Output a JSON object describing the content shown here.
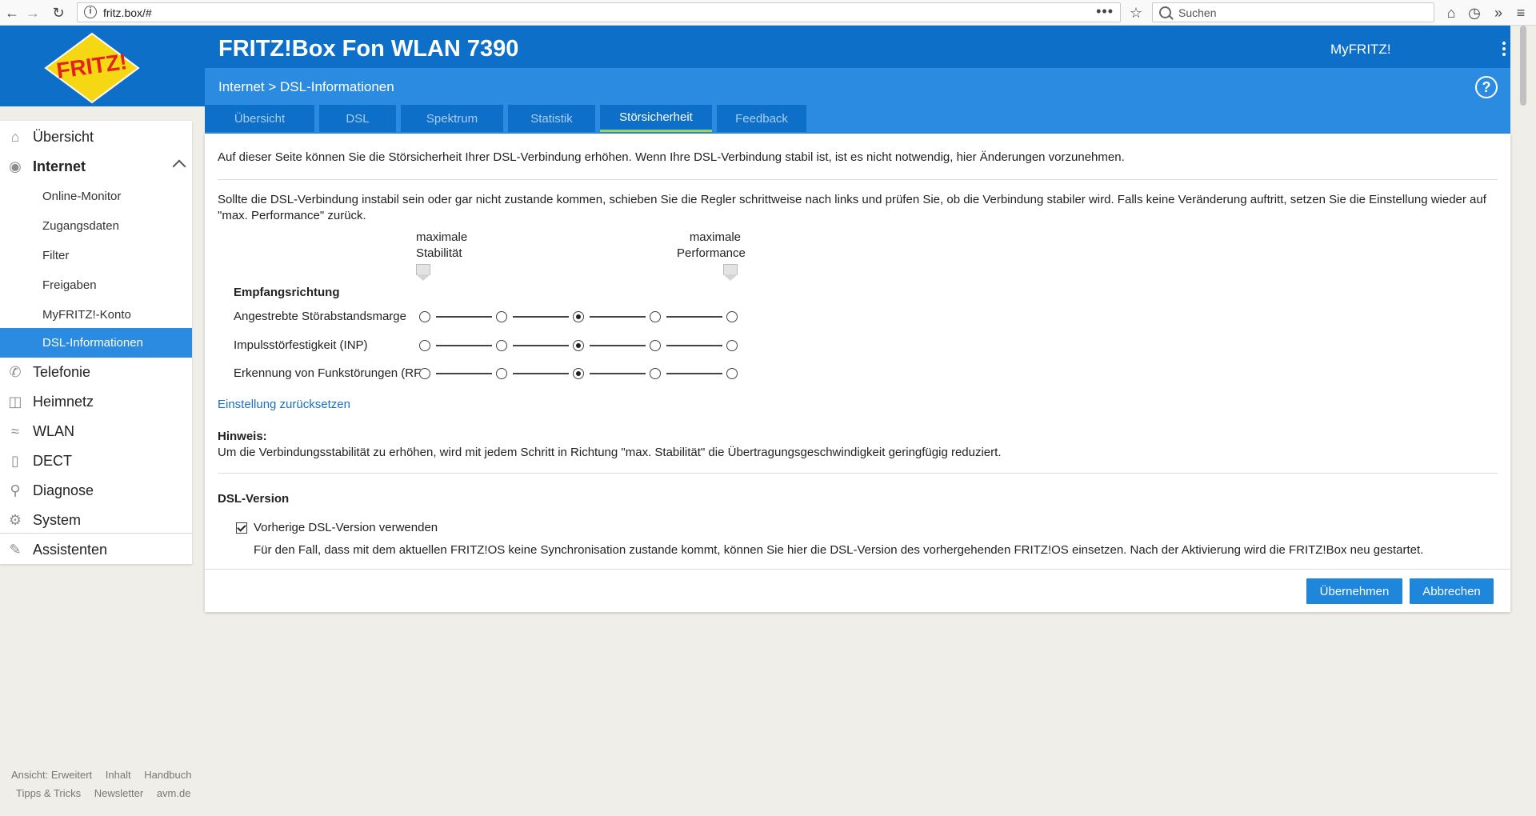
{
  "browser": {
    "url": "fritz.box/#",
    "search_placeholder": "Suchen"
  },
  "header": {
    "product": "FRITZ!Box Fon WLAN 7390",
    "myfritz": "MyFRITZ!",
    "breadcrumb": "Internet > DSL-Informationen",
    "help": "?",
    "logo_text": "FRITZ!"
  },
  "tabs": [
    {
      "label": "Übersicht"
    },
    {
      "label": "DSL"
    },
    {
      "label": "Spektrum"
    },
    {
      "label": "Statistik"
    },
    {
      "label": "Störsicherheit"
    },
    {
      "label": "Feedback"
    }
  ],
  "active_tab": "Störsicherheit",
  "sidebar": {
    "items": [
      {
        "label": "Übersicht",
        "icon": "home-icon"
      },
      {
        "label": "Internet",
        "icon": "globe-icon"
      },
      {
        "label": "Telefonie",
        "icon": "phone-icon"
      },
      {
        "label": "Heimnetz",
        "icon": "network-icon"
      },
      {
        "label": "WLAN",
        "icon": "wifi-icon"
      },
      {
        "label": "DECT",
        "icon": "dect-icon"
      },
      {
        "label": "Diagnose",
        "icon": "diagnose-icon"
      },
      {
        "label": "System",
        "icon": "gear-icon"
      },
      {
        "label": "Assistenten",
        "icon": "wizard-icon"
      }
    ],
    "internet_sub": [
      {
        "label": "Online-Monitor"
      },
      {
        "label": "Zugangsdaten"
      },
      {
        "label": "Filter"
      },
      {
        "label": "Freigaben"
      },
      {
        "label": "MyFRITZ!-Konto"
      },
      {
        "label": "DSL-Informationen"
      }
    ],
    "footer_row1": [
      "Ansicht: Erweitert",
      "Inhalt",
      "Handbuch"
    ],
    "footer_row2": [
      "Tipps & Tricks",
      "Newsletter",
      "avm.de"
    ]
  },
  "main": {
    "intro": "Auf dieser Seite können Sie die Störsicherheit Ihrer DSL-Verbindung erhöhen. Wenn Ihre DSL-Verbindung stabil ist, ist es nicht notwendig, hier Änderungen vorzunehmen.",
    "paragraph": "Sollte die DSL-Verbindung instabil sein oder gar nicht zustande kommen, schieben Sie die Regler schrittweise nach links und prüfen Sie, ob die Verbindung stabiler wird. Falls keine Veränderung auftritt, setzen Sie die Einstellung wieder auf \"max. Performance\" zurück.",
    "label_left_1": "maximale",
    "label_left_2": "Stabilität",
    "label_right_1": "maximale",
    "label_right_2": "Performance",
    "section": "Empfangsrichtung",
    "rows": [
      {
        "label": "Angestrebte Störabstandsmarge",
        "selected": 3
      },
      {
        "label": "Impulsstörfestigkeit (INP)",
        "selected": 3
      },
      {
        "label": "Erkennung von Funkstörungen (RFI)",
        "selected": 3
      }
    ],
    "reset_link": "Einstellung zurücksetzen",
    "hint_title": "Hinweis:",
    "hint_text": "Um die Verbindungsstabilität zu erhöhen, wird mit jedem Schritt in Richtung \"max. Stabilität\" die Übertragungsgeschwindigkeit geringfügig reduziert.",
    "dsl_version_title": "DSL-Version",
    "checkbox_label": "Vorherige DSL-Version verwenden",
    "checkbox_checked": true,
    "checkbox_desc": "Für den Fall, dass mit dem aktuellen FRITZ!OS keine Synchronisation zustande kommt, können Sie hier die DSL-Version des vorhergehenden FRITZ!OS einsetzen. Nach der Aktivierung wird die FRITZ!Box neu gestartet.",
    "btn_apply": "Übernehmen",
    "btn_cancel": "Abbrechen"
  },
  "colors": {
    "header_blue": "#0d6fc7",
    "subheader_blue": "#2a8be0",
    "active_underline": "#9ed35b",
    "button_blue": "#1e86db",
    "link_blue": "#1a6fbf"
  }
}
